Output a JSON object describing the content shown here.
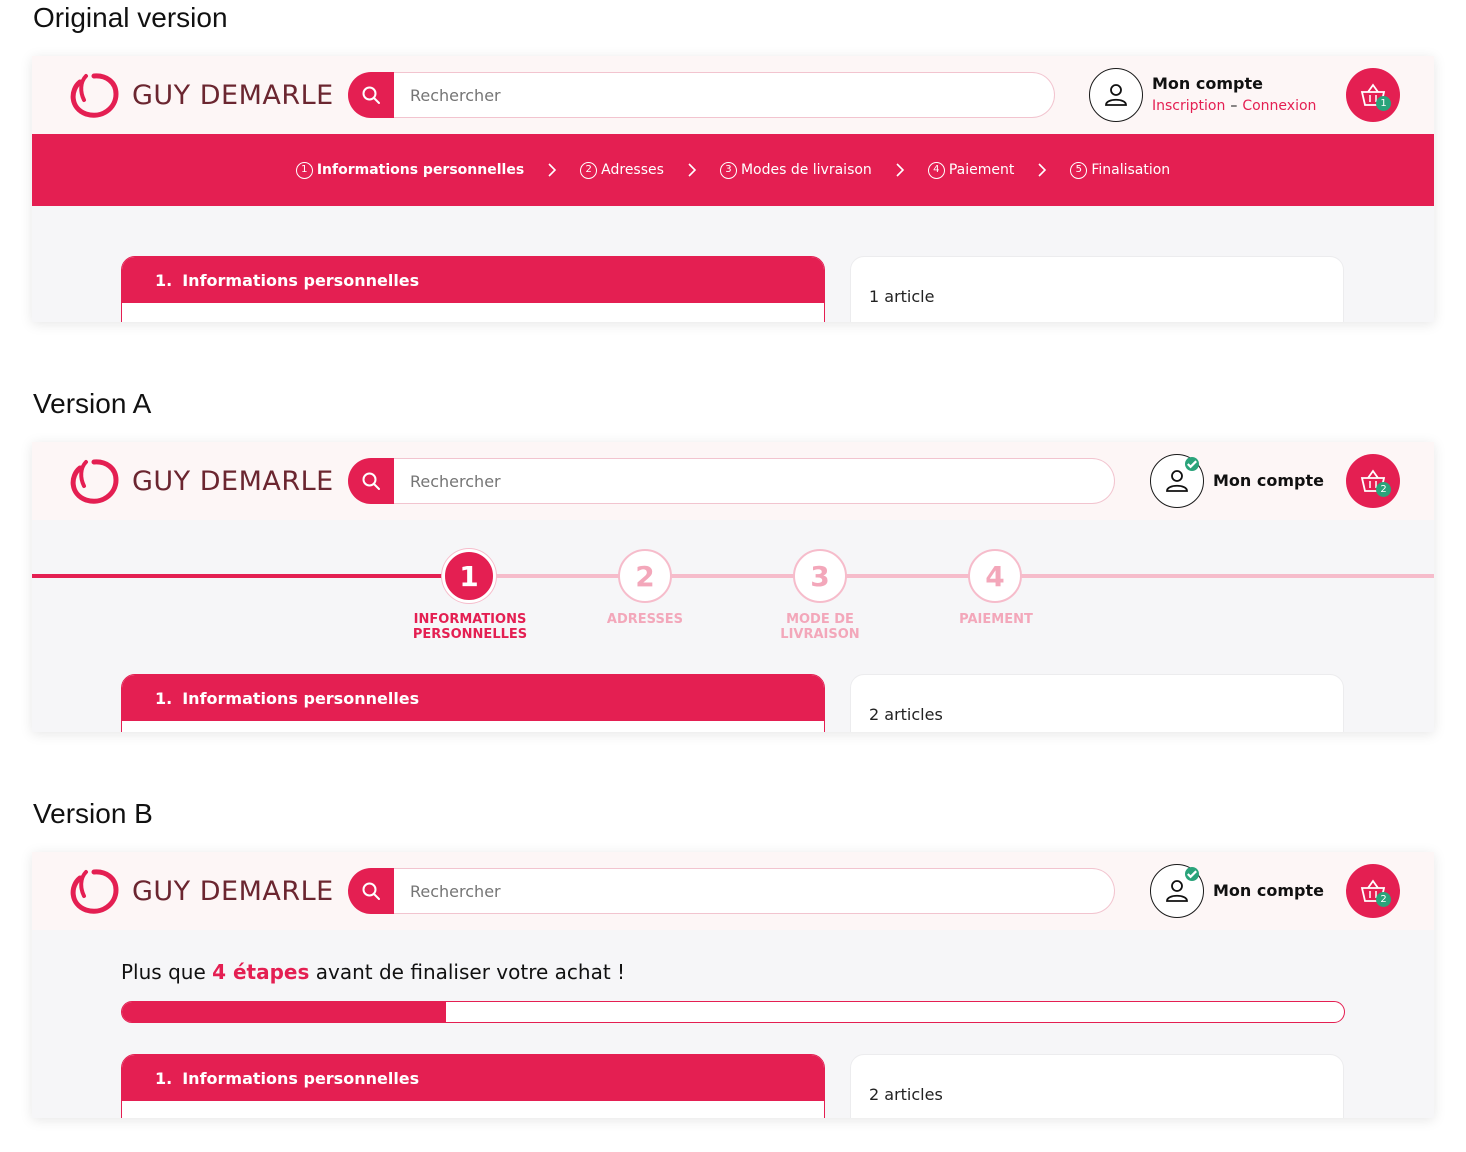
{
  "labels": {
    "original": "Original version",
    "version_a": "Version A",
    "version_b": "Version B"
  },
  "brand": {
    "name": "GUY DEMARLE",
    "accent": "#e41f52",
    "logo_color": "#6b2630"
  },
  "search": {
    "placeholder": "Rechercher"
  },
  "original": {
    "account": {
      "title": "Mon compte",
      "signup": "Inscription",
      "separator": "–",
      "login": "Connexion"
    },
    "cart_count": "1",
    "steps": [
      {
        "num": "1",
        "label": "Informations personnelles",
        "active": true
      },
      {
        "num": "2",
        "label": "Adresses",
        "active": false
      },
      {
        "num": "3",
        "label": "Modes de livraison",
        "active": false
      },
      {
        "num": "4",
        "label": "Paiement",
        "active": false
      },
      {
        "num": "5",
        "label": "Finalisation",
        "active": false
      }
    ],
    "section": {
      "num": "1.",
      "title": "Informations personnelles"
    },
    "summary": "1 article"
  },
  "version_a": {
    "account": {
      "title": "Mon compte"
    },
    "cart_count": "2",
    "steps": [
      {
        "num": "1",
        "label_line1": "INFORMATIONS",
        "label_line2": "PERSONNELLES",
        "active": true
      },
      {
        "num": "2",
        "label_line1": "ADRESSES",
        "label_line2": "",
        "active": false
      },
      {
        "num": "3",
        "label_line1": "MODE DE",
        "label_line2": "LIVRAISON",
        "active": false
      },
      {
        "num": "4",
        "label_line1": "PAIEMENT",
        "label_line2": "",
        "active": false
      }
    ],
    "section": {
      "num": "1.",
      "title": "Informations personnelles"
    },
    "summary": "2 articles"
  },
  "version_b": {
    "account": {
      "title": "Mon compte"
    },
    "cart_count": "2",
    "progress": {
      "prefix": "Plus que",
      "highlight": "4 étapes",
      "suffix": "avant de finaliser votre achat !",
      "fraction": 0.265
    },
    "section": {
      "num": "1.",
      "title": "Informations personnelles"
    },
    "summary": "2 articles"
  }
}
